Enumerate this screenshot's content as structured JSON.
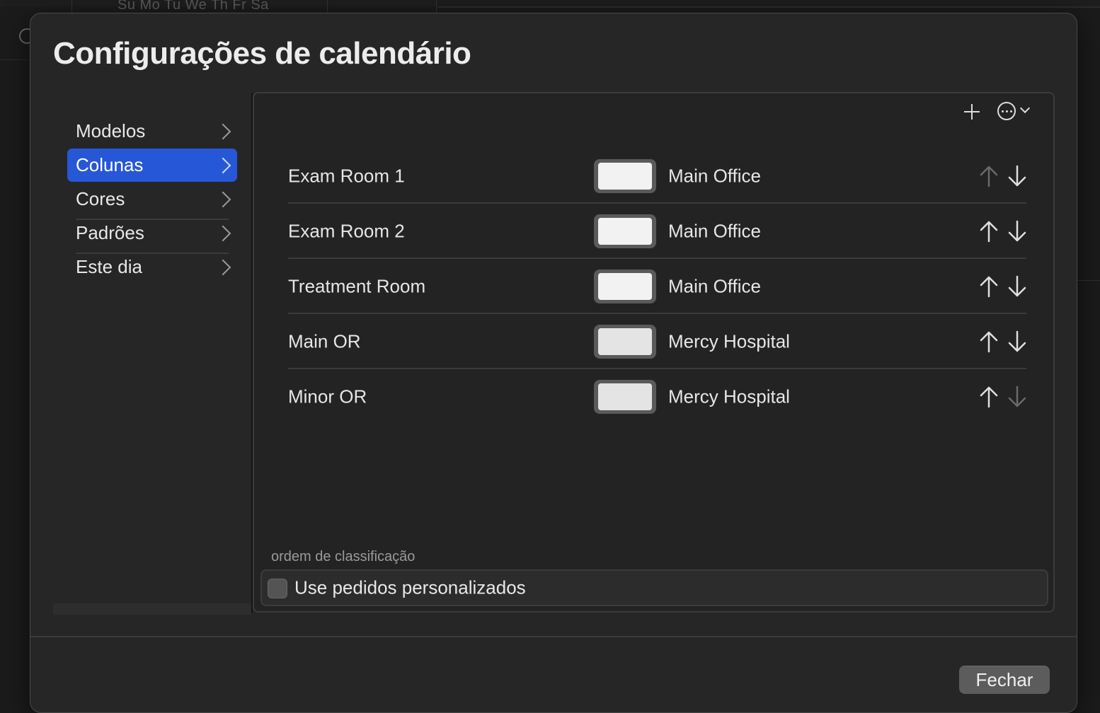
{
  "background": {
    "weekdays": "Su Mo  Tu We  Th   Fr  Sa"
  },
  "dialog": {
    "title": "Configurações de calendário",
    "close_label": "Fechar"
  },
  "sidebar": {
    "items": [
      {
        "label": "Modelos",
        "active": false
      },
      {
        "label": "Colunas",
        "active": true
      },
      {
        "label": "Cores",
        "active": false
      },
      {
        "label": "Padrões",
        "active": false
      },
      {
        "label": "Este dia",
        "active": false
      }
    ]
  },
  "toolbar": {
    "add_icon": "plus-icon",
    "more_icon": "ellipsis-circle-icon"
  },
  "columns": [
    {
      "name": "Exam Room 1",
      "color": "#f2f2f2",
      "location": "Main Office",
      "can_move_up": false,
      "can_move_down": true
    },
    {
      "name": "Exam Room 2",
      "color": "#f2f2f2",
      "location": "Main Office",
      "can_move_up": true,
      "can_move_down": true
    },
    {
      "name": "Treatment Room",
      "color": "#f2f2f2",
      "location": "Main Office",
      "can_move_up": true,
      "can_move_down": true
    },
    {
      "name": "Main OR",
      "color": "#e4e4e4",
      "location": "Mercy Hospital",
      "can_move_up": true,
      "can_move_down": true
    },
    {
      "name": "Minor OR",
      "color": "#e4e4e4",
      "location": "Mercy Hospital",
      "can_move_up": true,
      "can_move_down": false
    }
  ],
  "sort": {
    "section_label": "ordem de classificação",
    "checkbox_label": "Use pedidos personalizados",
    "checked": false
  },
  "colors": {
    "accent": "#2657d6",
    "enabled_arrow": "#e0e0e0",
    "disabled_arrow": "#6a6a6a"
  }
}
